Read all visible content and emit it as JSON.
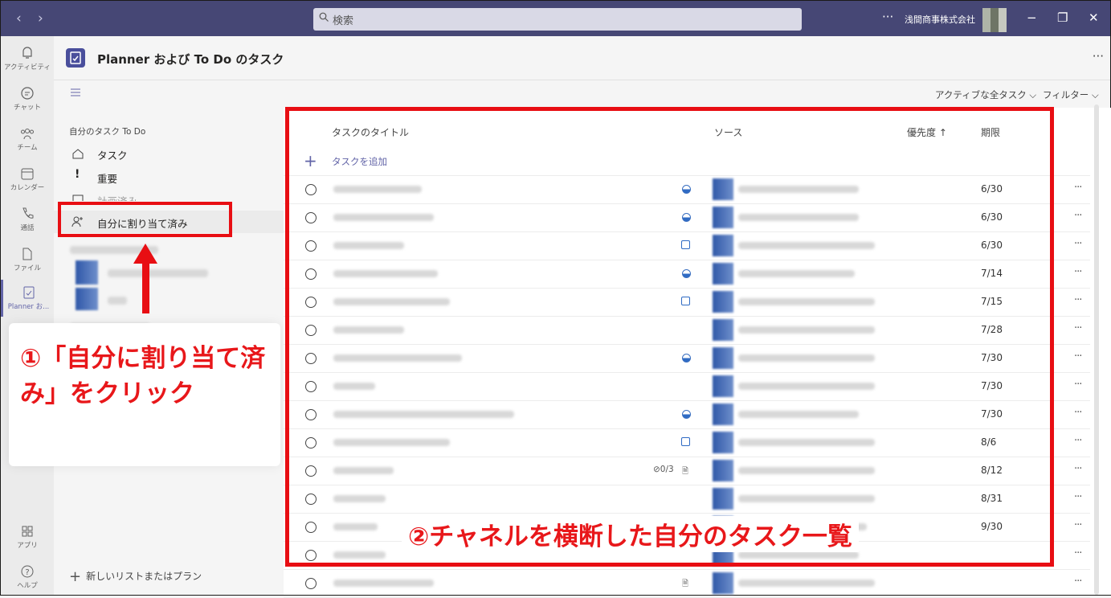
{
  "titlebar": {
    "search_placeholder": "検索",
    "more": "···",
    "org_name": "浅間商事株式会社",
    "minimize": "−",
    "maximize": "❐",
    "close": "✕"
  },
  "rail": [
    {
      "label": "アクティビティ",
      "icon": "bell-icon"
    },
    {
      "label": "チャット",
      "icon": "chat-icon"
    },
    {
      "label": "チーム",
      "icon": "team-icon"
    },
    {
      "label": "カレンダー",
      "icon": "calendar-icon"
    },
    {
      "label": "通話",
      "icon": "phone-icon"
    },
    {
      "label": "ファイル",
      "icon": "file-icon"
    },
    {
      "label": "Planner お...",
      "icon": "planner-icon"
    },
    {
      "label": "アプリ",
      "icon": "apps-icon"
    },
    {
      "label": "ヘルプ",
      "icon": "help-icon"
    }
  ],
  "app": {
    "title": "Planner および To Do のタスク",
    "more": "···"
  },
  "toolbar": {
    "filter_active": "アクティブな全タスク",
    "filter_label": "フィルター"
  },
  "left_panel": {
    "heading": "自分のタスク To Do",
    "items": [
      {
        "label": "タスク"
      },
      {
        "label": "重要"
      },
      {
        "label": "計画済み"
      },
      {
        "label": "自分に割り当て済み"
      }
    ],
    "new_list": "新しいリストまたはプラン"
  },
  "annotations": {
    "step1": "①「自分に割り当て済み」をクリック",
    "step2": "②チャネルを横断した自分のタスク一覧"
  },
  "table": {
    "columns": {
      "title": "タスクのタイトル",
      "source": "ソース",
      "priority": "優先度 ↑",
      "due": "期限"
    },
    "add_task": "タスクを追加",
    "rows": [
      {
        "due": "6/30",
        "priority": "half"
      },
      {
        "due": "6/30",
        "priority": "half"
      },
      {
        "due": "6/30",
        "priority": "square"
      },
      {
        "due": "7/14",
        "priority": "half"
      },
      {
        "due": "7/15",
        "priority": "square"
      },
      {
        "due": "7/28",
        "priority": "none"
      },
      {
        "due": "7/30",
        "priority": "half"
      },
      {
        "due": "7/30",
        "priority": "none"
      },
      {
        "due": "7/30",
        "priority": "half"
      },
      {
        "due": "8/6",
        "priority": "square"
      },
      {
        "due": "8/12",
        "priority": "note",
        "checklist": "⊘0/3"
      },
      {
        "due": "8/31",
        "priority": "none"
      },
      {
        "due": "9/30",
        "priority": "none"
      },
      {
        "due": "",
        "priority": "none"
      },
      {
        "due": "",
        "priority": "note"
      }
    ]
  }
}
